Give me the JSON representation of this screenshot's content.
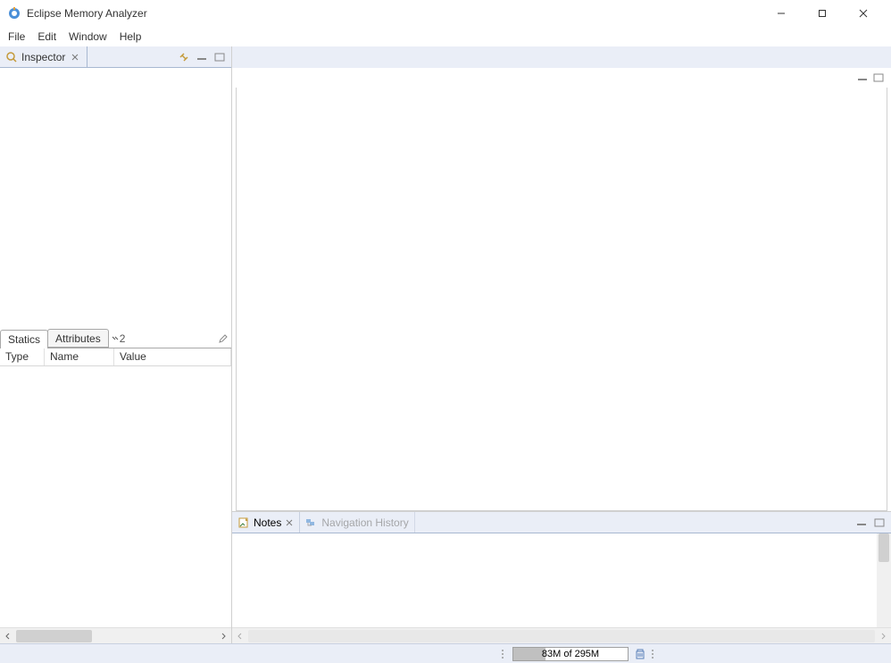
{
  "window": {
    "title": "Eclipse Memory Analyzer"
  },
  "menu": {
    "items": [
      "File",
      "Edit",
      "Window",
      "Help"
    ]
  },
  "inspector": {
    "title": "Inspector",
    "tabs": [
      "Statics",
      "Attributes"
    ],
    "more_count": "2",
    "columns": [
      "Type",
      "Name",
      "Value"
    ]
  },
  "bottom": {
    "notes": "Notes",
    "nav_history": "Navigation History"
  },
  "status": {
    "heap": "83M of 295M"
  }
}
